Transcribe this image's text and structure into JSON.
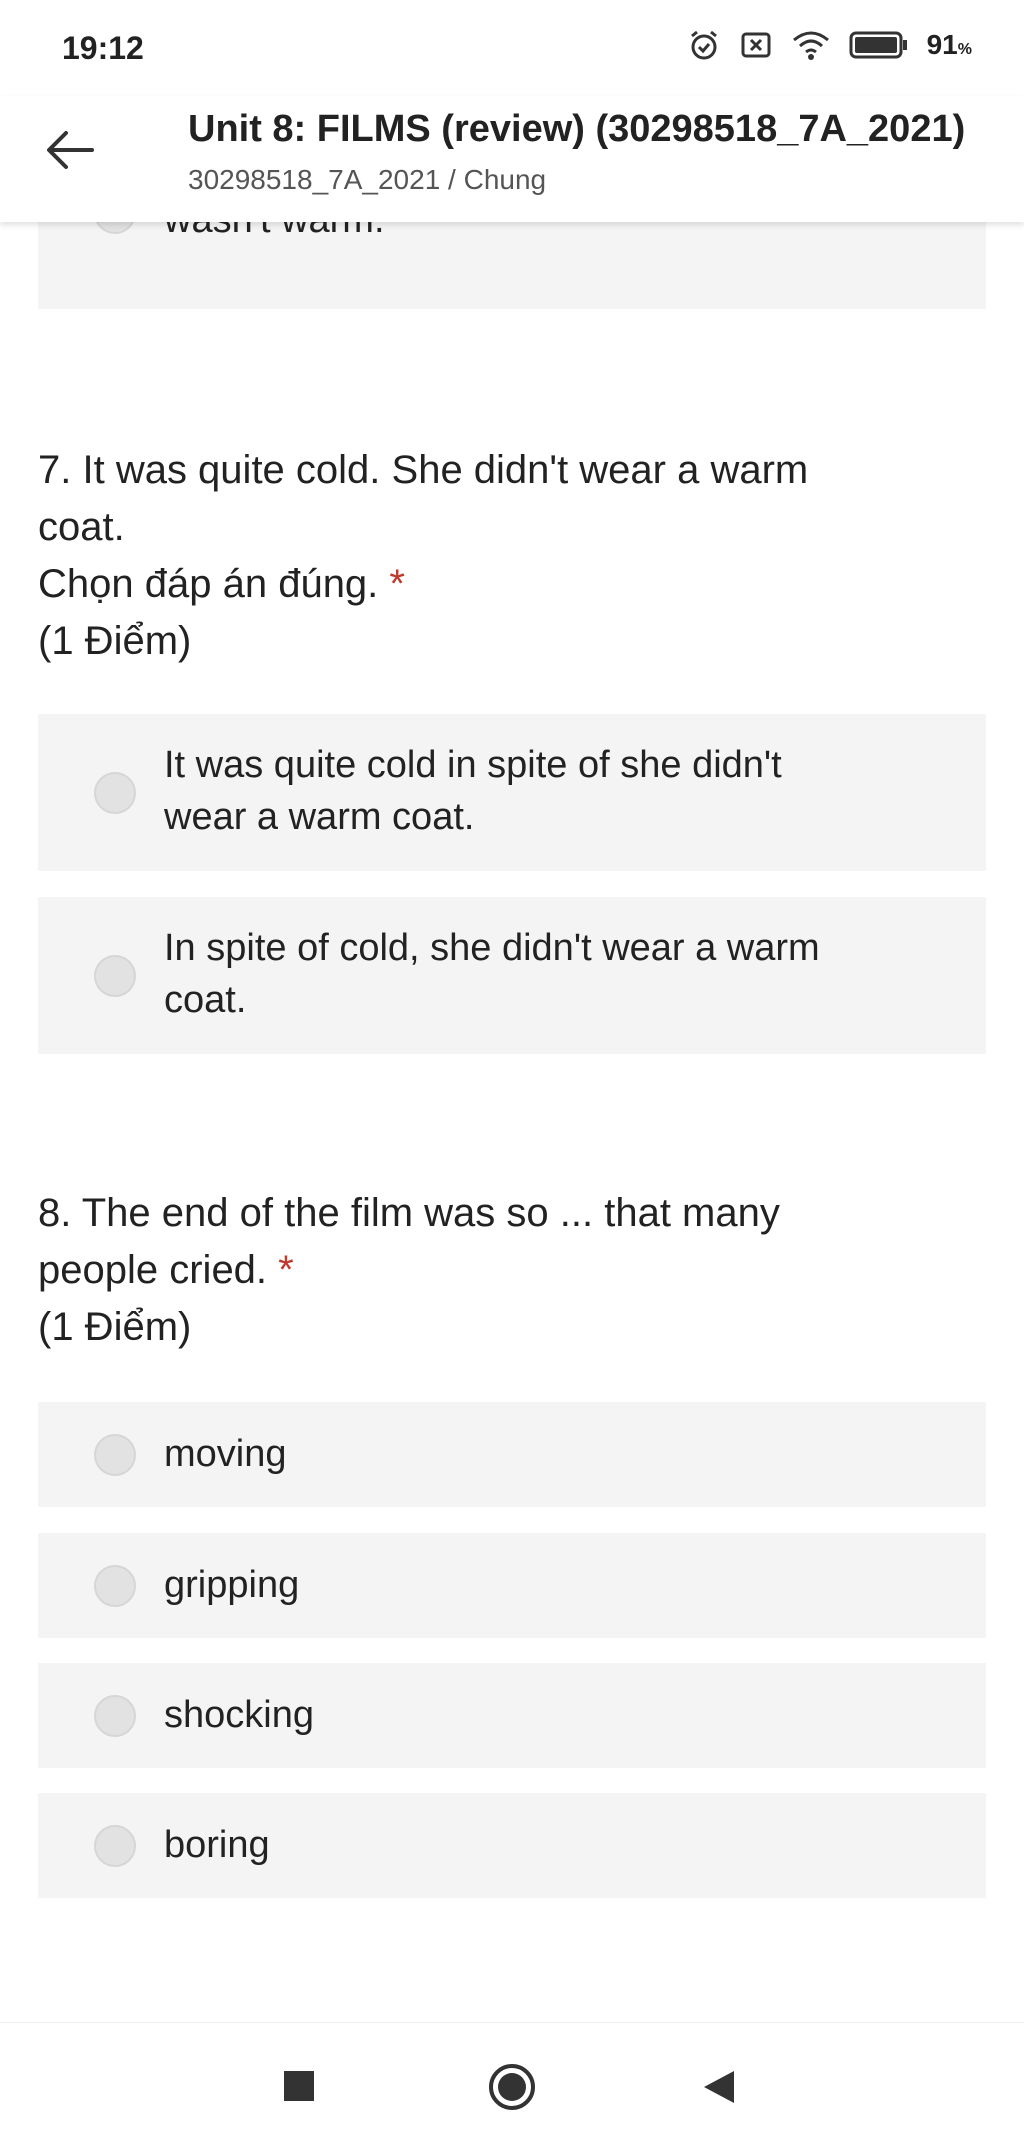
{
  "status_bar": {
    "time": "19:12",
    "battery_percent": "91",
    "battery_unit": "%",
    "icons": [
      "alarm-icon",
      "notification-blocked-icon",
      "wifi-icon",
      "battery-icon"
    ]
  },
  "header": {
    "title": "Unit 8: FILMS (review) (30298518_7A_2021)",
    "subtitle": "30298518_7A_2021 / Chung"
  },
  "prev_question": {
    "partial_option": "wasn't warm."
  },
  "questions": [
    {
      "text_line1": "7. It was quite cold. She didn't wear a warm",
      "text_line2": "coat.",
      "instruction": "Chọn đáp án đúng.",
      "required_mark": "*",
      "points": "(1 Điểm)",
      "options": [
        {
          "line1": "It was quite cold in spite of she didn't",
          "line2": "wear a warm coat."
        },
        {
          "line1": "In spite of cold, she didn't wear a warm",
          "line2": "coat."
        }
      ]
    },
    {
      "text_line1": "8. The end of the film was so ... that many",
      "text_line2": "people cried.",
      "required_mark": "*",
      "points": "(1 Điểm)",
      "options": [
        "moving",
        "gripping",
        "shocking",
        "boring"
      ]
    }
  ],
  "nav_bar": {
    "buttons": [
      "recents-button",
      "home-button",
      "back-button"
    ]
  }
}
